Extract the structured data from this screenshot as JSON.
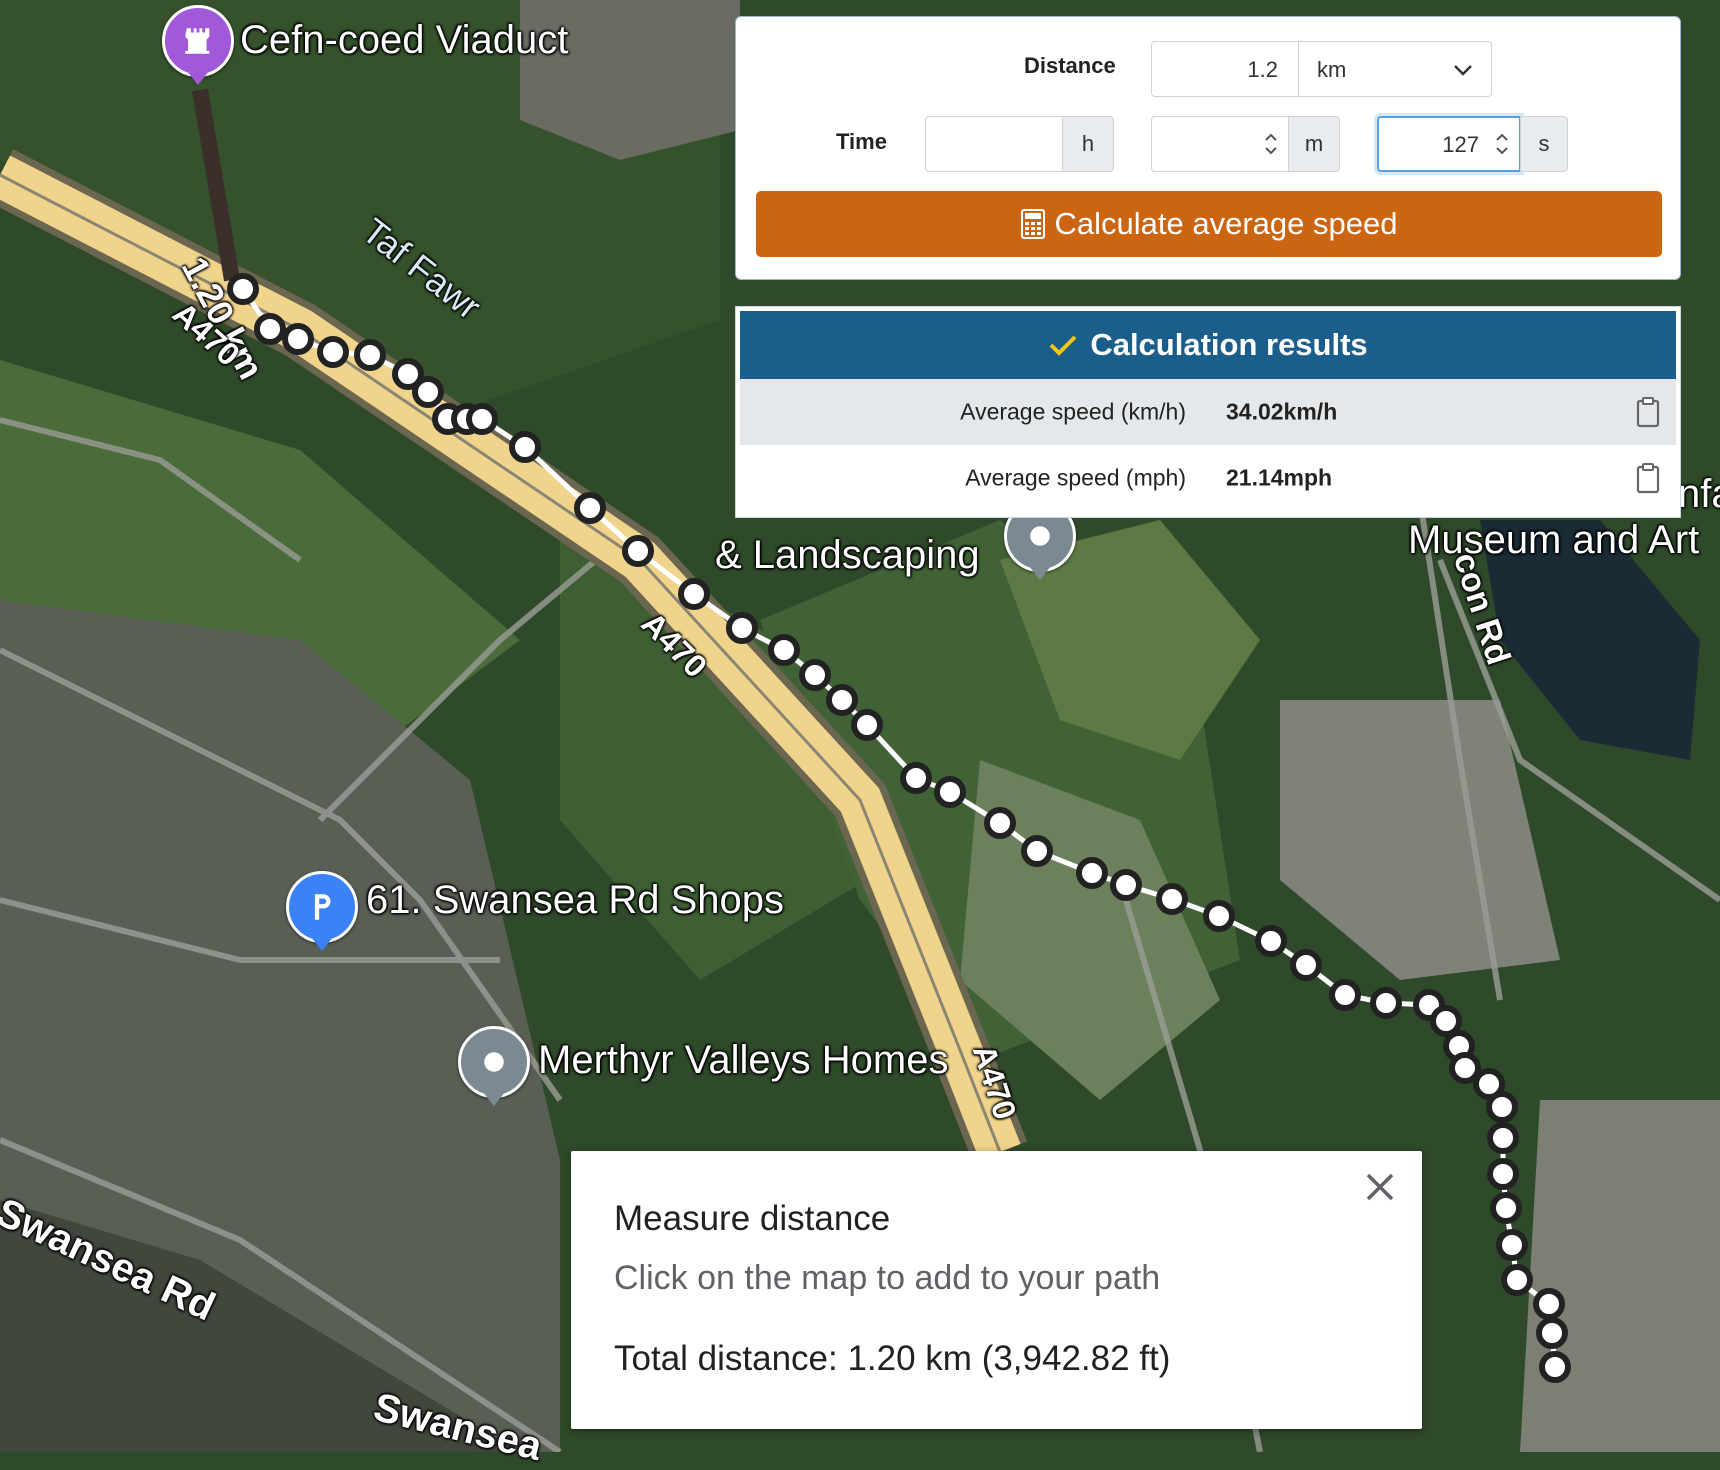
{
  "map": {
    "labels": {
      "viaduct": "Cefn-coed Viaduct",
      "segment_length": "1.20 km",
      "river": "Taf Fawr",
      "road_a470_1": "A470",
      "road_a470_2": "A470",
      "road_a470_3": "A470",
      "fencing": "& Landscaping",
      "museum": "Museum and Art",
      "museum_fragment": "nfa",
      "con_rd": "con Rd",
      "shops": "61. Swansea Rd Shops",
      "homes": "Merthyr Valleys Homes",
      "swansea_rd_1": "Swansea Rd",
      "swansea_rd_2": "Swansea"
    },
    "icons": {
      "viaduct": "castle-icon",
      "shops": "parking-icon",
      "fencing": "place-marker-icon",
      "homes": "place-marker-icon"
    },
    "colors": {
      "viaduct_pin": "#a259d9",
      "parking_pin": "#3b82f6",
      "place_pin": "#7b8a92",
      "road": "#f0d48c"
    }
  },
  "calculator": {
    "distance_label": "Distance",
    "distance_value": "1.2",
    "distance_unit": "km",
    "time_label": "Time",
    "hours_value": "",
    "hours_unit": "h",
    "minutes_value": "",
    "minutes_unit": "m",
    "seconds_value": "127",
    "seconds_unit": "s",
    "calculate_label": "Calculate average speed",
    "button_color": "#cc6512"
  },
  "results": {
    "title": "Calculation results",
    "header_color": "#1b5e8c",
    "rows": [
      {
        "label": "Average speed (km/h)",
        "value": "34.02km/h"
      },
      {
        "label": "Average speed (mph)",
        "value": "21.14mph"
      }
    ]
  },
  "measure": {
    "title": "Measure distance",
    "hint": "Click on the map to add to your path",
    "total": "Total distance: 1.20 km (3,942.82 ft)"
  }
}
